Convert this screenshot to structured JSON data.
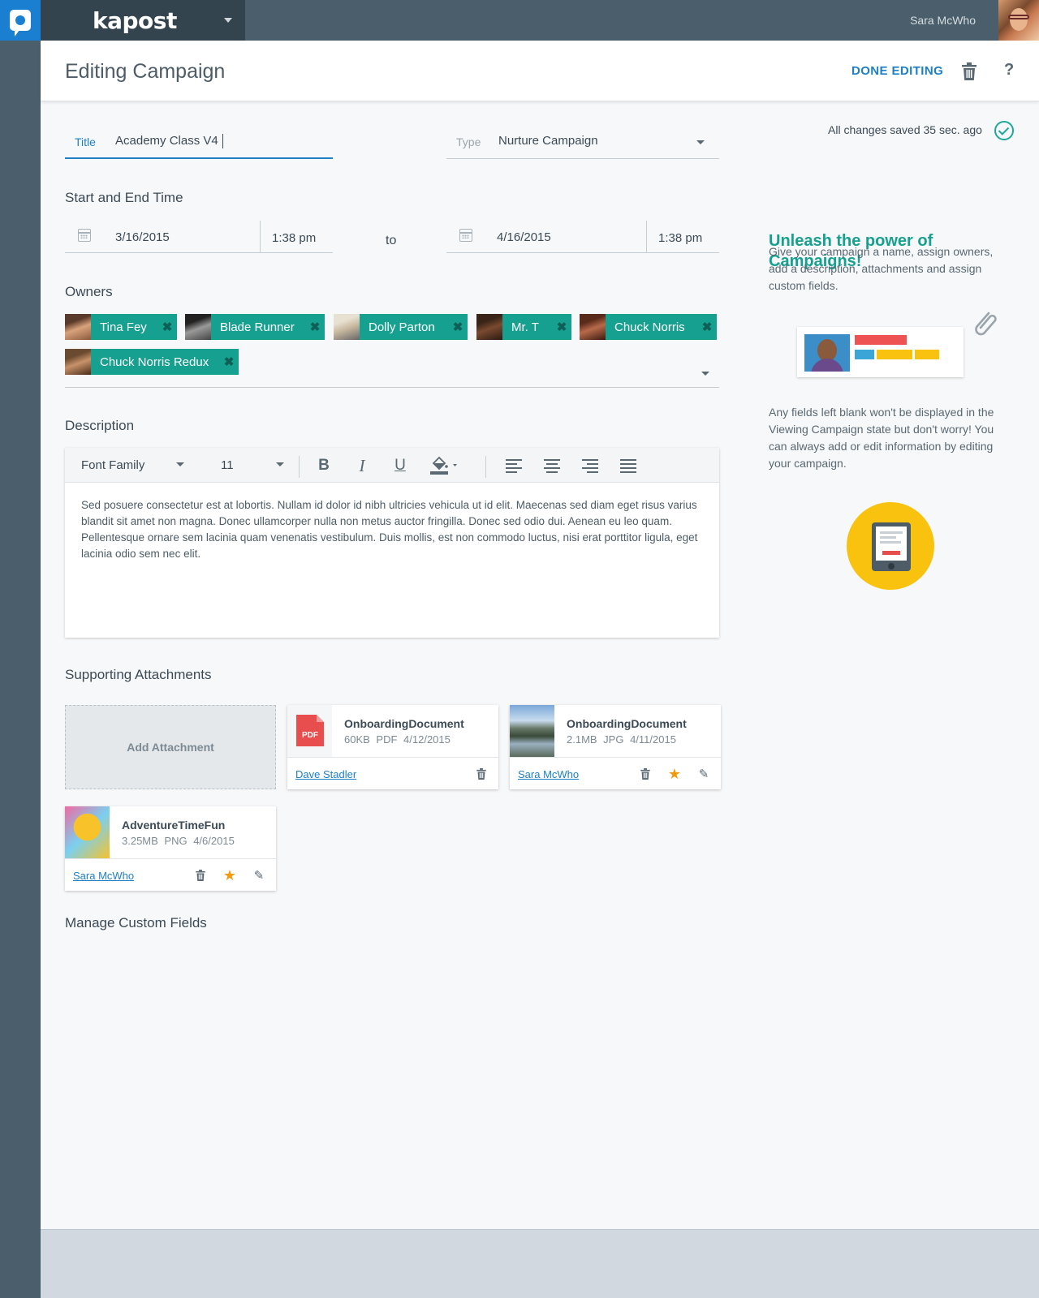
{
  "app": {
    "brand": "kapost",
    "user_name": "Sara McWho"
  },
  "header": {
    "title": "Editing Campaign",
    "done_label": "DONE EDITING"
  },
  "status": {
    "saved_text": "All changes saved 35 sec. ago"
  },
  "form": {
    "title_label": "Title",
    "title_value": "Academy Class V4",
    "type_label": "Type",
    "type_value": "Nurture Campaign",
    "time_section_label": "Start and End Time",
    "start_date": "3/16/2015",
    "start_time": "1:38 pm",
    "to_label": "to",
    "end_date": "4/16/2015",
    "end_time": "1:38 pm",
    "owners_label": "Owners",
    "owners": [
      {
        "name": "Tina Fey"
      },
      {
        "name": "Blade Runner"
      },
      {
        "name": "Dolly Parton"
      },
      {
        "name": "Mr. T"
      },
      {
        "name": "Chuck Norris"
      },
      {
        "name": "Chuck Norris Redux"
      }
    ],
    "description_label": "Description",
    "toolbar": {
      "font_family": "Font Family",
      "font_size": "11",
      "bold": "B",
      "italic": "I",
      "underline": "U"
    },
    "description_text": "Sed posuere consectetur est at lobortis. Nullam id dolor id nibh ultricies vehicula ut id elit. Maecenas sed diam eget risus varius blandit sit amet non magna. Donec ullamcorper nulla non metus auctor fringilla. Donec sed odio dui. Aenean eu leo quam. Pellentesque ornare sem lacinia quam venenatis vestibulum. Duis mollis, est non commodo luctus, nisi erat porttitor ligula, eget lacinia odio sem nec elit.",
    "attachments_label": "Supporting Attachments",
    "add_attachment_label": "Add Attachment",
    "attachments": [
      {
        "name": "OnboardingDocument",
        "meta": "60KB PDF 4/12/2015",
        "owner": "Dave Stadler",
        "thumb_text": "PDF"
      },
      {
        "name": "OnboardingDocument",
        "meta": "2.1MB JPG 4/11/2015",
        "owner": "Sara McWho"
      },
      {
        "name": "AdventureTimeFun",
        "meta": "3.25MB PNG 4/6/2015",
        "owner": "Sara McWho"
      }
    ],
    "custom_fields_label": "Manage Custom Fields"
  },
  "sidebar": {
    "title": "Unleash the power of Campaigns!",
    "intro": "Give your campaign a name, assign owners, add a description, attachments and assign custom fields.",
    "note": "Any fields left blank won't be displayed in the Viewing Campaign state but don't worry! You can always add or edit information by editing your campaign."
  },
  "colors": {
    "accent": "#1e7fc6",
    "teal": "#16a08f",
    "star": "#f29a0e",
    "topbar": "#4a5f6b"
  }
}
